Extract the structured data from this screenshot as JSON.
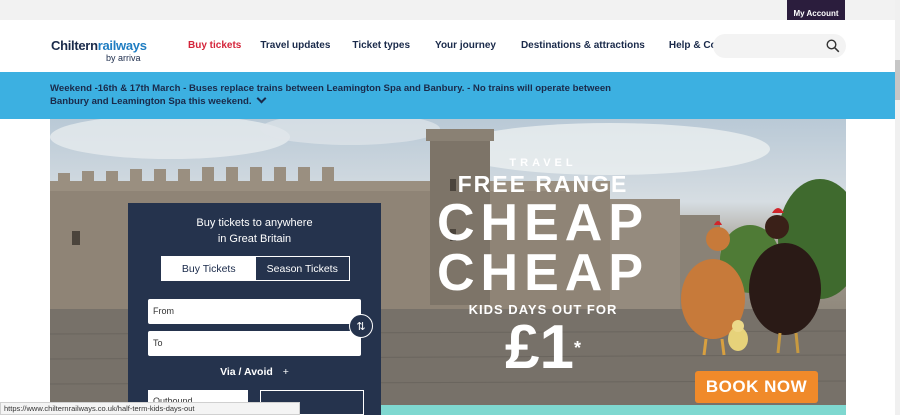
{
  "account": {
    "label": "My Account"
  },
  "logo": {
    "part1": "Chiltern",
    "part2": "railways",
    "sub": "by arriva"
  },
  "nav": {
    "items": [
      {
        "label": "Buy tickets"
      },
      {
        "label": "Travel updates"
      },
      {
        "label": "Ticket types"
      },
      {
        "label": "Your journey"
      },
      {
        "label": "Destinations & attractions"
      },
      {
        "label": "Help & Contact"
      }
    ]
  },
  "search": {
    "placeholder": ""
  },
  "banner": {
    "text": "Weekend -16th & 17th March - Buses replace trains between Leamington Spa and Banbury. - No trains will operate between Banbury and Leamington Spa this weekend."
  },
  "promo": {
    "travel": "TRAVEL",
    "free_range": "FREE RANGE",
    "cheap1": "CHEAP",
    "cheap2": "CHEAP",
    "kids": "KIDS DAYS OUT FOR",
    "price": "£1",
    "asterisk": "*",
    "book_now": "BOOK NOW"
  },
  "ticket_panel": {
    "title_line1": "Buy tickets to anywhere",
    "title_line2": "in Great Britain",
    "tab_buy": "Buy Tickets",
    "tab_season": "Season Tickets",
    "from_placeholder": "From",
    "to_placeholder": "To",
    "via_label": "Via / Avoid",
    "via_plus": "+",
    "outbound_placeholder": "Outbound"
  },
  "status_url": "https://www.chilternrailways.co.uk/half-term-kids-days-out",
  "colors": {
    "brand_navy": "#25334d",
    "active_red": "#d4243a",
    "banner_blue": "#3cb0e1",
    "book_orange": "#f08a2a",
    "account_purple": "#2b1d3d"
  }
}
